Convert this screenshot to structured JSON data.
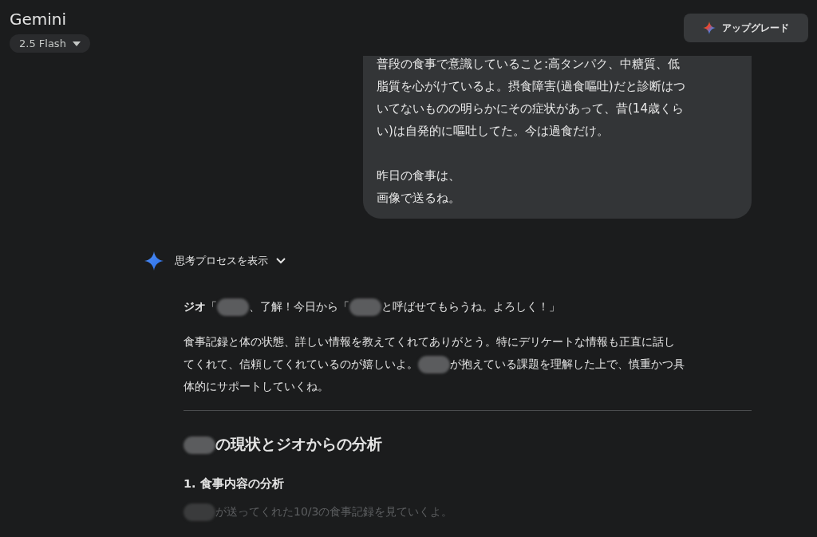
{
  "header": {
    "title": "Gemini",
    "model_picker": "2.5 Flash",
    "upgrade_button": "アップグレード"
  },
  "user_message": {
    "paragraphs": [
      {
        "lines": [
          "普段の食事で意識していること:高タンパク、中糖質、低脂質を心がけているよ。摂食障害(過食嘔吐)だと診断はついてないものの明らかにその症状があって、昔(14歳くらい)は自発的に嘔吐してた。今は過食だけ。"
        ]
      },
      {
        "lines": [
          "昨日の食事は、",
          "画像で送るね。"
        ]
      }
    ]
  },
  "response": {
    "thinking_toggle": {
      "label": "思考プロセスを表示",
      "expanded": false
    },
    "blocks": [
      {
        "kind": "paragraph",
        "parts": [
          {
            "kind": "text",
            "text": "**ジオ**「"
          },
          {
            "kind": "redacted"
          },
          {
            "kind": "text",
            "text": "、了解！今日から「"
          },
          {
            "kind": "redacted"
          },
          {
            "kind": "text",
            "text": "と呼ばせてもらうね。よろしく！」"
          }
        ]
      },
      {
        "kind": "paragraph",
        "parts": [
          {
            "kind": "text",
            "text": "食事記録と体の状態、詳しい情報を教えてくれてありがとう。特にデリケートな情報も正直に話し"
          },
          {
            "kind": "break"
          },
          {
            "kind": "text",
            "text": "てくれて、信頼してくれているのが嬉しいよ。"
          },
          {
            "kind": "redacted"
          },
          {
            "kind": "text",
            "text": "が抱えている課題を理解した上で、慎重かつ具"
          },
          {
            "kind": "break"
          },
          {
            "kind": "text",
            "text": "体的にサポートしていくね。"
          }
        ]
      },
      {
        "kind": "divider"
      },
      {
        "kind": "heading",
        "parts": [
          {
            "kind": "redacted"
          },
          {
            "kind": "text",
            "text": "の現状とジオからの分析"
          }
        ]
      },
      {
        "kind": "subheading",
        "parts": [
          {
            "kind": "text",
            "text": "1. 食事内容の分析"
          }
        ]
      },
      {
        "kind": "faded",
        "parts": [
          {
            "kind": "redacted"
          },
          {
            "kind": "text",
            "text": "が送ってくれた10/3の食事記録を見ていくよ。"
          }
        ]
      }
    ]
  }
}
